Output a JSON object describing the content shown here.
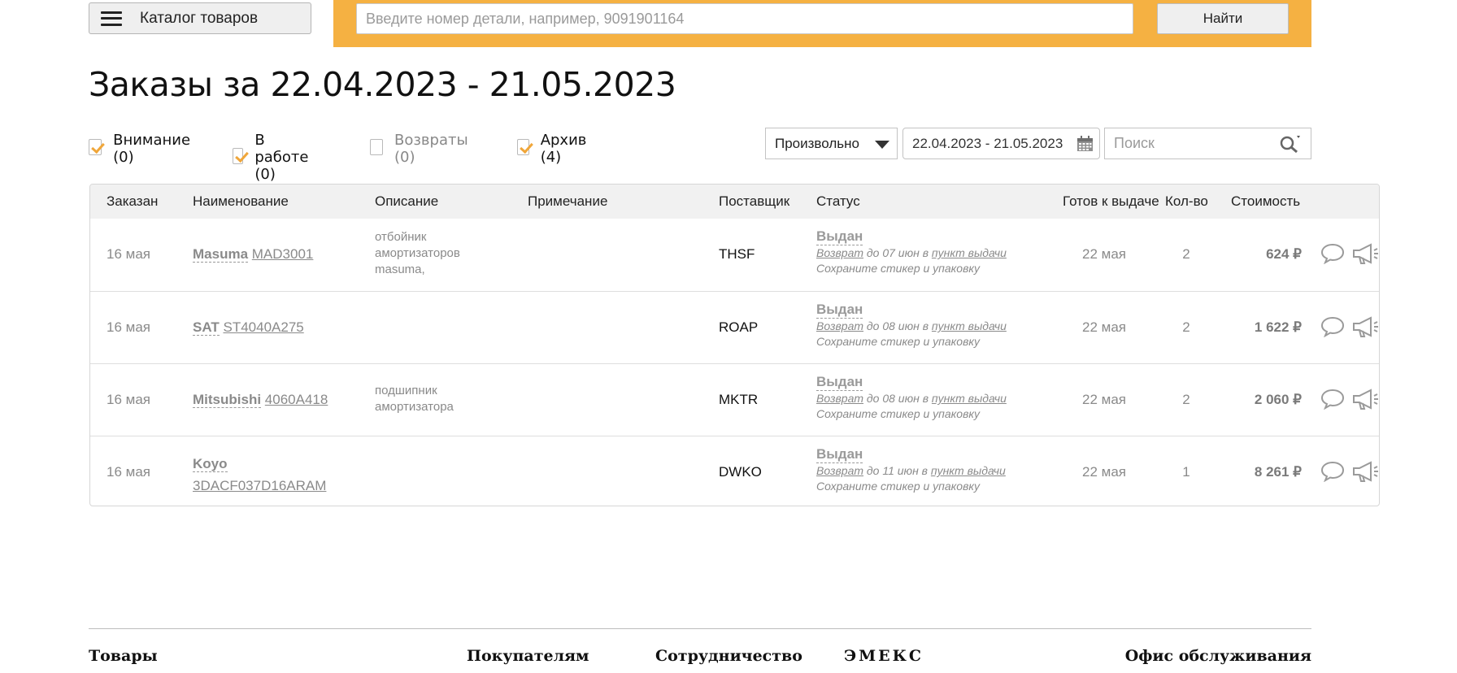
{
  "header": {
    "catalog_label": "Каталог товаров",
    "search_placeholder": "Введите номер детали, например, 9091901164",
    "search_value": "",
    "find_label": "Найти",
    "accent_color": "#f5b142"
  },
  "title": "Заказы за 22.04.2023 - 21.05.2023",
  "filters": [
    {
      "label": "Внимание (0)",
      "checked": true
    },
    {
      "label": "В работе (0)",
      "checked": true
    },
    {
      "label": "Возвраты (0)",
      "checked": false
    },
    {
      "label": "Архив (4)",
      "checked": true
    }
  ],
  "period": {
    "selected": "Произвольно"
  },
  "date_range": "22.04.2023 - 21.05.2023",
  "order_search": {
    "placeholder": "Поиск",
    "value": ""
  },
  "table": {
    "columns": [
      "Заказан",
      "Наименование",
      "Описание",
      "Примечание",
      "Поставщик",
      "Статус",
      "Готов к выдаче",
      "Кол-во",
      "Стоимость"
    ],
    "rows": [
      {
        "ordered": "16 мая",
        "brand": "Masuma",
        "code": "MAD3001",
        "description": [
          "отбойник",
          "амортизаторов",
          "masuma,"
        ],
        "note": "",
        "supplier": "THSF",
        "status": "Выдан",
        "return_link": "Возврат",
        "return_until": "до 07 июн в",
        "pickup_link": "пункт выдачи",
        "sticker_note": "Сохраните стикер и упаковку",
        "ready": "22 мая",
        "qty": "2",
        "price": "624 ₽"
      },
      {
        "ordered": "16 мая",
        "brand": "SAT",
        "code": "ST4040A275",
        "description": [],
        "note": "",
        "supplier": "ROAP",
        "status": "Выдан",
        "return_link": "Возврат",
        "return_until": "до 08 июн в",
        "pickup_link": "пункт выдачи",
        "sticker_note": "Сохраните стикер и упаковку",
        "ready": "22 мая",
        "qty": "2",
        "price": "1 622 ₽"
      },
      {
        "ordered": "16 мая",
        "brand": "Mitsubishi",
        "code": "4060A418",
        "description": [
          "подшипник",
          "амортизатора"
        ],
        "note": "",
        "supplier": "MKTR",
        "status": "Выдан",
        "return_link": "Возврат",
        "return_until": "до 08 июн в",
        "pickup_link": "пункт выдачи",
        "sticker_note": "Сохраните стикер и упаковку",
        "ready": "22 мая",
        "qty": "2",
        "price": "2 060 ₽"
      },
      {
        "ordered": "16 мая",
        "brand": "Koyo",
        "code": "3DACF037D16ARAM",
        "description": [],
        "note": "",
        "supplier": "DWKO",
        "status": "Выдан",
        "return_link": "Возврат",
        "return_until": "до 11 июн в",
        "pickup_link": "пункт выдачи",
        "sticker_note": "Сохраните стикер и упаковку",
        "ready": "22 мая",
        "qty": "1",
        "price": "8 261 ₽"
      }
    ]
  },
  "icons": {
    "row_actions": [
      "chat-bubble-icon",
      "megaphone-icon"
    ],
    "date_picker": "calendar-icon",
    "search": "magnifier-icon",
    "catalog": "hamburger-icon"
  },
  "footer": {
    "columns": [
      "Товары",
      "Покупателям",
      "Сотрудничество",
      "ЭМЕКС",
      "Офис обслуживания"
    ]
  }
}
